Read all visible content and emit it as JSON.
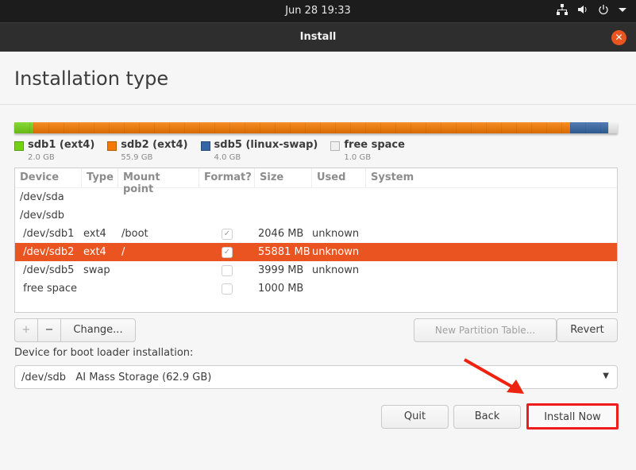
{
  "topbar": {
    "clock": "Jun 28  19:33",
    "icons": [
      "network-icon",
      "volume-icon",
      "power-icon",
      "menu-arrow-icon"
    ]
  },
  "window": {
    "title": "Install",
    "close_icon": "close-icon"
  },
  "page": {
    "title": "Installation type"
  },
  "partition_bar": [
    {
      "name": "sdb1 (ext4)",
      "size": "2.0 GB",
      "color": "#73d216",
      "fraction": 0.032
    },
    {
      "name": "sdb2 (ext4)",
      "size": "55.9 GB",
      "color": "#f57900",
      "fraction": 0.889
    },
    {
      "name": "sdb5 (linux-swap)",
      "size": "4.0 GB",
      "color": "#3465a4",
      "fraction": 0.063
    },
    {
      "name": "free space",
      "size": "1.0 GB",
      "color": "#f0f0f0",
      "fraction": 0.016
    }
  ],
  "table": {
    "headers": [
      "Device",
      "Type",
      "Mount point",
      "Format?",
      "Size",
      "Used",
      "System"
    ],
    "rows": [
      {
        "device": "/dev/sda",
        "type": "",
        "mount": "",
        "format": null,
        "size": "",
        "used": ""
      },
      {
        "device": "/dev/sdb",
        "type": "",
        "mount": "",
        "format": null,
        "size": "",
        "used": ""
      },
      {
        "device": " /dev/sdb1",
        "type": "ext4",
        "mount": "/boot",
        "format": true,
        "size": "2046 MB",
        "used": "unknown"
      },
      {
        "device": " /dev/sdb2",
        "type": "ext4",
        "mount": "/",
        "format": true,
        "size": "55881 MB",
        "used": "unknown",
        "selected": true
      },
      {
        "device": " /dev/sdb5",
        "type": "swap",
        "mount": "",
        "format": false,
        "size": "3999 MB",
        "used": "unknown"
      },
      {
        "device": " free space",
        "type": "",
        "mount": "",
        "format": false,
        "size": "1000 MB",
        "used": ""
      }
    ]
  },
  "toolbar": {
    "add": "+",
    "remove": "−",
    "change": "Change...",
    "new_table": "New Partition Table...",
    "revert": "Revert"
  },
  "bootloader": {
    "label": "Device for boot loader installation:",
    "value": "/dev/sdb   AI Mass Storage (62.9 GB)"
  },
  "buttons": {
    "quit": "Quit",
    "back": "Back",
    "install": "Install Now"
  },
  "annotation": {
    "highlight_color": "#ff1a1a"
  }
}
